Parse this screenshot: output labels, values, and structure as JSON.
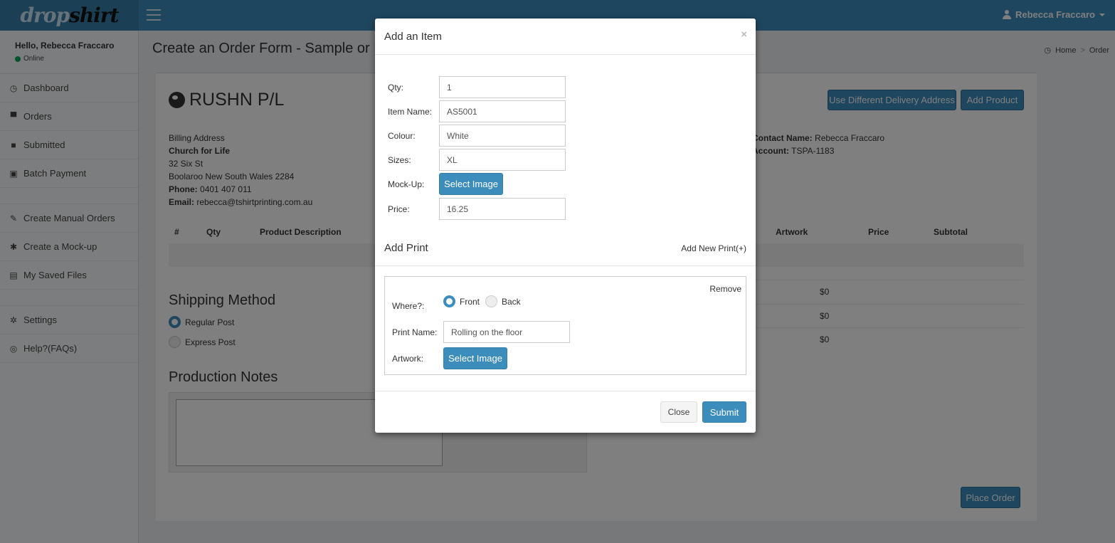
{
  "header": {
    "logo_light": "drop",
    "logo_dark": "shirt",
    "user_name": "Rebecca Fraccaro"
  },
  "sidebar": {
    "greeting": "Hello, Rebecca Fraccaro",
    "status": "Online",
    "items": [
      {
        "label": "Dashboard",
        "icon": "dashboard-icon"
      },
      {
        "label": "Orders",
        "icon": "cart-icon"
      },
      {
        "label": "Submitted",
        "icon": "folder-icon"
      },
      {
        "label": "Batch Payment",
        "icon": "money-icon"
      },
      {
        "label": "Create Manual Orders",
        "icon": "edit-icon"
      },
      {
        "label": "Create a Mock-up",
        "icon": "asterisk-icon"
      },
      {
        "label": "My Saved Files",
        "icon": "save-icon"
      },
      {
        "label": "Settings",
        "icon": "gear-icon"
      },
      {
        "label": "Help?(FAQs)",
        "icon": "lifebuoy-icon"
      }
    ]
  },
  "page": {
    "title": "Create an Order Form - Sample or M",
    "breadcrumb_home": "Home",
    "breadcrumb_current": "Order",
    "company": "RUSHN P/L",
    "btn_diff_address": "Use Different Delivery Address",
    "btn_add_product": "Add Product",
    "billing": {
      "label": "Billing Address",
      "name": "Church for Life",
      "street": "32 Six St",
      "city": "Boolaroo New South Wales 2284",
      "phone_label": "Phone:",
      "phone": "0401 407 011",
      "email_label": "Email:",
      "email": "rebecca@tshirtprinting.com.au"
    },
    "contact": {
      "name_label": "Contact Name:",
      "name": "Rebecca Fraccaro",
      "account_label": "Account:",
      "account": "TSPA-1183"
    },
    "table_headers": {
      "num": "#",
      "qty": "Qty",
      "desc": "Product Description",
      "artwork": "Artwork",
      "price": "Price",
      "subtotal": "Subtotal"
    },
    "fees": [
      "$0",
      "$0",
      "$0"
    ],
    "shipping_title": "Shipping Method",
    "shipping_regular": "Regular Post",
    "shipping_express": "Express Post",
    "notes_title": "Production Notes",
    "place_order": "Place Order"
  },
  "modal": {
    "title": "Add an Item",
    "close_x": "×",
    "fields": {
      "qty_label": "Qty:",
      "qty": "1",
      "item_label": "Item Name:",
      "item": "AS5001",
      "colour_label": "Colour:",
      "colour": "White",
      "sizes_label": "Sizes:",
      "sizes": "XL",
      "mockup_label": "Mock-Up:",
      "mockup_btn": "Select Image",
      "price_label": "Price:",
      "price": "16.25"
    },
    "add_print_title": "Add Print",
    "add_new_print": "Add New Print(+)",
    "print": {
      "remove": "Remove",
      "where_label": "Where?:",
      "front": "Front",
      "back": "Back",
      "name_label": "Print Name:",
      "name": "Rolling on the floor",
      "artwork_label": "Artwork:",
      "artwork_btn": "Select Image"
    },
    "close_btn": "Close",
    "submit_btn": "Submit"
  }
}
